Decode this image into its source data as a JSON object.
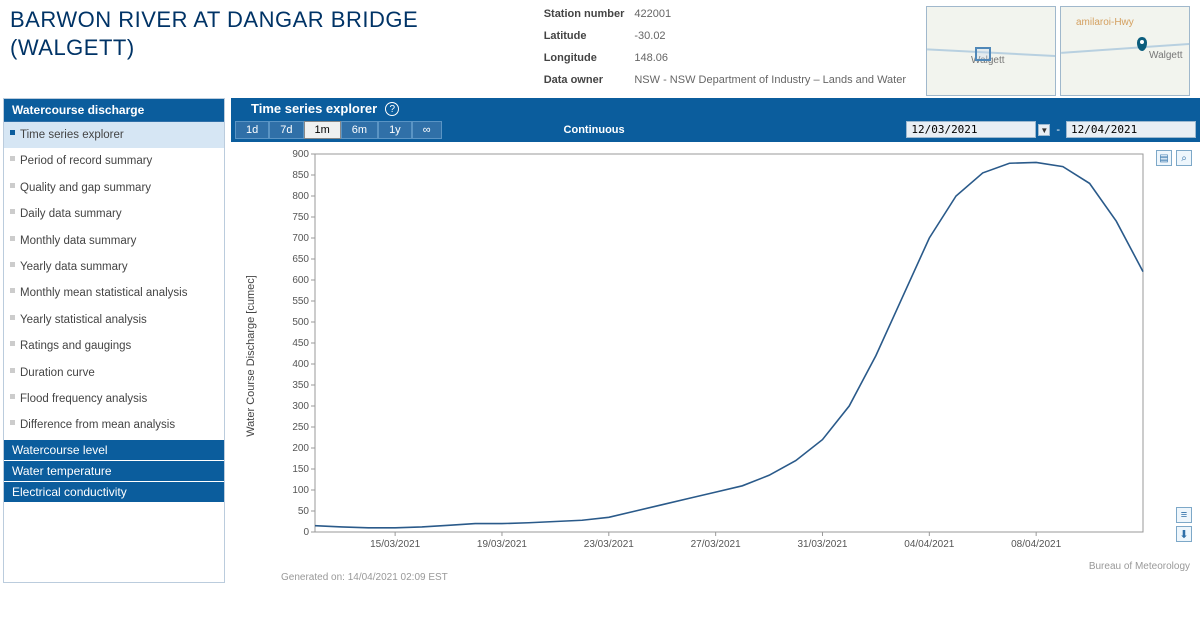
{
  "title": "BARWON RIVER AT DANGAR BRIDGE (WALGETT)",
  "station": {
    "number_k": "Station number",
    "number_v": "422001",
    "lat_k": "Latitude",
    "lat_v": "-30.02",
    "lon_k": "Longitude",
    "lon_v": "148.06",
    "owner_k": "Data owner",
    "owner_v": "NSW - NSW Department of Industry – Lands and Water"
  },
  "map": {
    "town": "Walgett",
    "hwy": "amilaroi-Hwy"
  },
  "sidebar": {
    "section": "Watercourse discharge",
    "items": [
      "Time series explorer",
      "Period of record summary",
      "Quality and gap summary",
      "Daily data summary",
      "Monthly data summary",
      "Yearly data summary",
      "Monthly mean statistical analysis",
      "Yearly statistical analysis",
      "Ratings and gaugings",
      "Duration curve",
      "Flood frequency analysis",
      "Difference from mean analysis"
    ],
    "others": [
      "Watercourse level",
      "Water temperature",
      "Electrical conductivity"
    ]
  },
  "panel_title": "Time series explorer",
  "ranges": [
    "1d",
    "7d",
    "1m",
    "6m",
    "1y",
    "∞"
  ],
  "range_active": "1m",
  "continuous": "Continuous",
  "date_from": "12/03/2021",
  "date_to": "12/04/2021",
  "ylabel": "Water Course Discharge [cumec]",
  "generated": "Generated on: 14/04/2021 02:09 EST",
  "attribution": "Bureau of Meteorology",
  "chart_data": {
    "type": "line",
    "xlabel": "",
    "ylabel": "Water Course Discharge [cumec]",
    "ylim": [
      0,
      900
    ],
    "x_ticks": [
      "15/03/2021",
      "19/03/2021",
      "23/03/2021",
      "27/03/2021",
      "31/03/2021",
      "04/04/2021",
      "08/04/2021"
    ],
    "y_ticks": [
      0,
      50,
      100,
      150,
      200,
      250,
      300,
      350,
      400,
      450,
      500,
      550,
      600,
      650,
      700,
      750,
      800,
      850,
      900
    ],
    "x": [
      "12/03/2021",
      "13/03/2021",
      "14/03/2021",
      "15/03/2021",
      "16/03/2021",
      "17/03/2021",
      "18/03/2021",
      "19/03/2021",
      "20/03/2021",
      "21/03/2021",
      "22/03/2021",
      "23/03/2021",
      "24/03/2021",
      "25/03/2021",
      "26/03/2021",
      "27/03/2021",
      "28/03/2021",
      "29/03/2021",
      "30/03/2021",
      "31/03/2021",
      "01/04/2021",
      "02/04/2021",
      "03/04/2021",
      "04/04/2021",
      "05/04/2021",
      "06/04/2021",
      "07/04/2021",
      "08/04/2021",
      "09/04/2021",
      "10/04/2021",
      "11/04/2021",
      "12/04/2021"
    ],
    "values": [
      15,
      12,
      10,
      10,
      12,
      16,
      20,
      20,
      22,
      25,
      28,
      35,
      50,
      65,
      80,
      95,
      110,
      135,
      170,
      220,
      300,
      420,
      560,
      700,
      800,
      855,
      878,
      880,
      870,
      830,
      740,
      620
    ]
  }
}
